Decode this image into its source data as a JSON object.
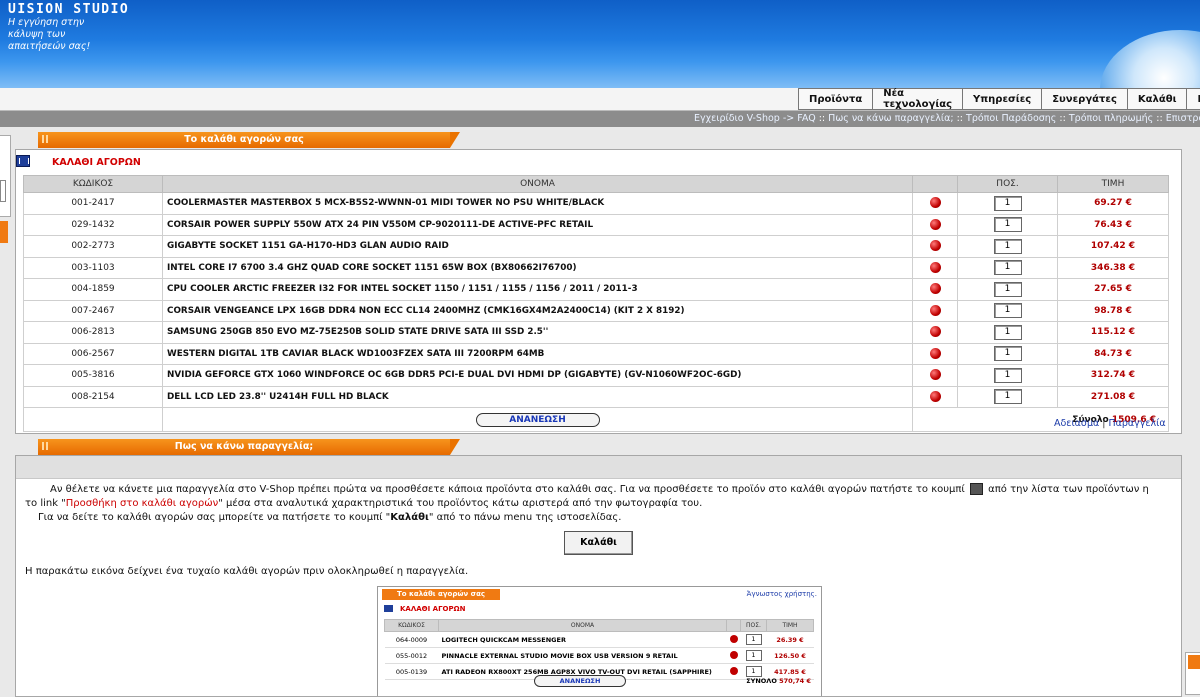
{
  "header": {
    "brand": "UISION STUDIO",
    "tagline_1": "Η εγγύηση στην",
    "tagline_2": "κάλυψη των",
    "tagline_3": "απαιτήσεών σας!"
  },
  "nav": {
    "items": [
      "Προϊόντα",
      "Νέα τεχνολογίας",
      "Υπηρεσίες",
      "Συνεργάτες",
      "Καλάθι",
      "Π"
    ]
  },
  "subnav": {
    "items": [
      "Εγχειρίδιο V-Shop",
      "FAQ",
      "Πως να κάνω παραγγελία;",
      "Τρόποι Παράδοσης",
      "Τρόποι πληρωμής",
      "Επιστροφές π"
    ],
    "arrow": "->",
    "sep": "::"
  },
  "cart": {
    "tab_title": "Το καλάθι αγορών σας",
    "heading": "ΚΑΛΑΘΙ ΑΓΟΡΩΝ",
    "columns": {
      "code": "ΚΩΔΙΚΟΣ",
      "name": "ΟΝΟΜΑ",
      "qty": "ΠΟΣ.",
      "price": "ΤΙΜΗ"
    },
    "rows": [
      {
        "code": "001-2417",
        "name": "COOLERMASTER MASTERBOX 5 MCX-B5S2-WWNN-01 MIDI TOWER NO PSU WHITE/BLACK",
        "qty": "1",
        "price": "69.27 €"
      },
      {
        "code": "029-1432",
        "name": "CORSAIR POWER SUPPLY 550W ATX 24 PIN V550M CP-9020111-DE ACTIVE-PFC RETAIL",
        "qty": "1",
        "price": "76.43 €"
      },
      {
        "code": "002-2773",
        "name": "GIGABYTE SOCKET 1151 GA-H170-HD3 GLAN AUDIO RAID",
        "qty": "1",
        "price": "107.42 €"
      },
      {
        "code": "003-1103",
        "name": "INTEL CORE I7 6700 3.4 GHZ QUAD CORE SOCKET 1151 65W BOX (BX80662I76700)",
        "qty": "1",
        "price": "346.38 €"
      },
      {
        "code": "004-1859",
        "name": "CPU COOLER ARCTIC FREEZER I32 FOR INTEL SOCKET 1150 / 1151 / 1155 / 1156 / 2011 / 2011-3",
        "qty": "1",
        "price": "27.65 €"
      },
      {
        "code": "007-2467",
        "name": "CORSAIR VENGEANCE LPX 16GB DDR4 NON ECC CL14 2400MHZ (CMK16GX4M2A2400C14) (KIT 2 X 8192)",
        "qty": "1",
        "price": "98.78 €"
      },
      {
        "code": "006-2813",
        "name": "SAMSUNG 250GB 850 EVO MZ-75E250B SOLID STATE DRIVE SATA III SSD 2.5''",
        "qty": "1",
        "price": "115.12 €"
      },
      {
        "code": "006-2567",
        "name": "WESTERN DIGITAL 1TB CAVIAR BLACK WD1003FZEX SATA III 7200RPM 64MB",
        "qty": "1",
        "price": "84.73 €"
      },
      {
        "code": "005-3816",
        "name": "NVIDIA GEFORCE GTX 1060 WINDFORCE OC 6GB DDR5 PCI-E DUAL DVI HDMI DP (GIGABYTE) (GV-N1060WF2OC-6GD)",
        "qty": "1",
        "price": "312.74 €"
      },
      {
        "code": "008-2154",
        "name": "DELL LCD LED 23.8'' U2414H FULL HD BLACK",
        "qty": "1",
        "price": "271.08 €"
      }
    ],
    "update_label": "ΑΝΑΝΕΩΣΗ",
    "total_label": "Σύνολο",
    "total_value": "1509.6 €",
    "link_empty": "Αδειασμα",
    "link_sep": "|",
    "link_order": "Παραγγελία"
  },
  "info": {
    "tab_title": "Πως να κάνω παραγγελία;",
    "p1_a": "Αν θέλετε να κάνετε μια παραγγελία στο V-Shop πρέπει πρώτα να προσθέσετε κάποια προϊόντα στο καλάθι σας. Για να προσθέσετε το προϊόν στο καλάθι αγορών πατήστε το κουμπί",
    "p1_b": "από την λίστα των προϊόντων η",
    "p2_a": "το link \"",
    "p2_link": "Προσθήκη στο καλάθι αγορών",
    "p2_b": "\" μέσα στα αναλυτικά χαρακτηριστικά του προϊόντος κάτω αριστερά από την φωτογραφία του.",
    "p3_a": "Για να δείτε το καλάθι αγορών σας μπορείτε να πατήσετε το κουμπί \"",
    "p3_bold": "Καλάθι",
    "p3_b": "\" από το πάνω menu της ιστοσελίδας.",
    "button": "Καλάθι",
    "note": "Η παρακάτω εικόνα δείχνει ένα τυχαίο καλάθι αγορών πριν ολοκληρωθεί η παραγγελία."
  },
  "sample": {
    "tab": "Το καλάθι αγορών σας",
    "link": "Άγνωστος χρήστης.",
    "heading": "ΚΑΛΑΘΙ ΑΓΟΡΩΝ",
    "columns": {
      "code": "ΚΩΔΙΚΟΣ",
      "name": "ΟΝΟΜΑ",
      "qty": "ΠΟΣ.",
      "price": "ΤΙΜΗ"
    },
    "rows": [
      {
        "code": "064-0009",
        "name": "LOGITECH QUICKCAM MESSENGER",
        "qty": "1",
        "price": "26.39 €"
      },
      {
        "code": "055-0012",
        "name": "PINNACLE EXTERNAL STUDIO MOVIE BOX USB VERSION 9 RETAIL",
        "qty": "1",
        "price": "126.50 €"
      },
      {
        "code": "005-0139",
        "name": "ATI RADEON RX800XT 256MB AGP8X VIVO TV-OUT DVI RETAIL (SAPPHIRE)",
        "qty": "1",
        "price": "417.85 €"
      }
    ],
    "update": "ΑΝΑΝΕΩΣΗ",
    "total_label": "ΣΥΝΟΛΟ",
    "total_value": "570,74 €"
  }
}
